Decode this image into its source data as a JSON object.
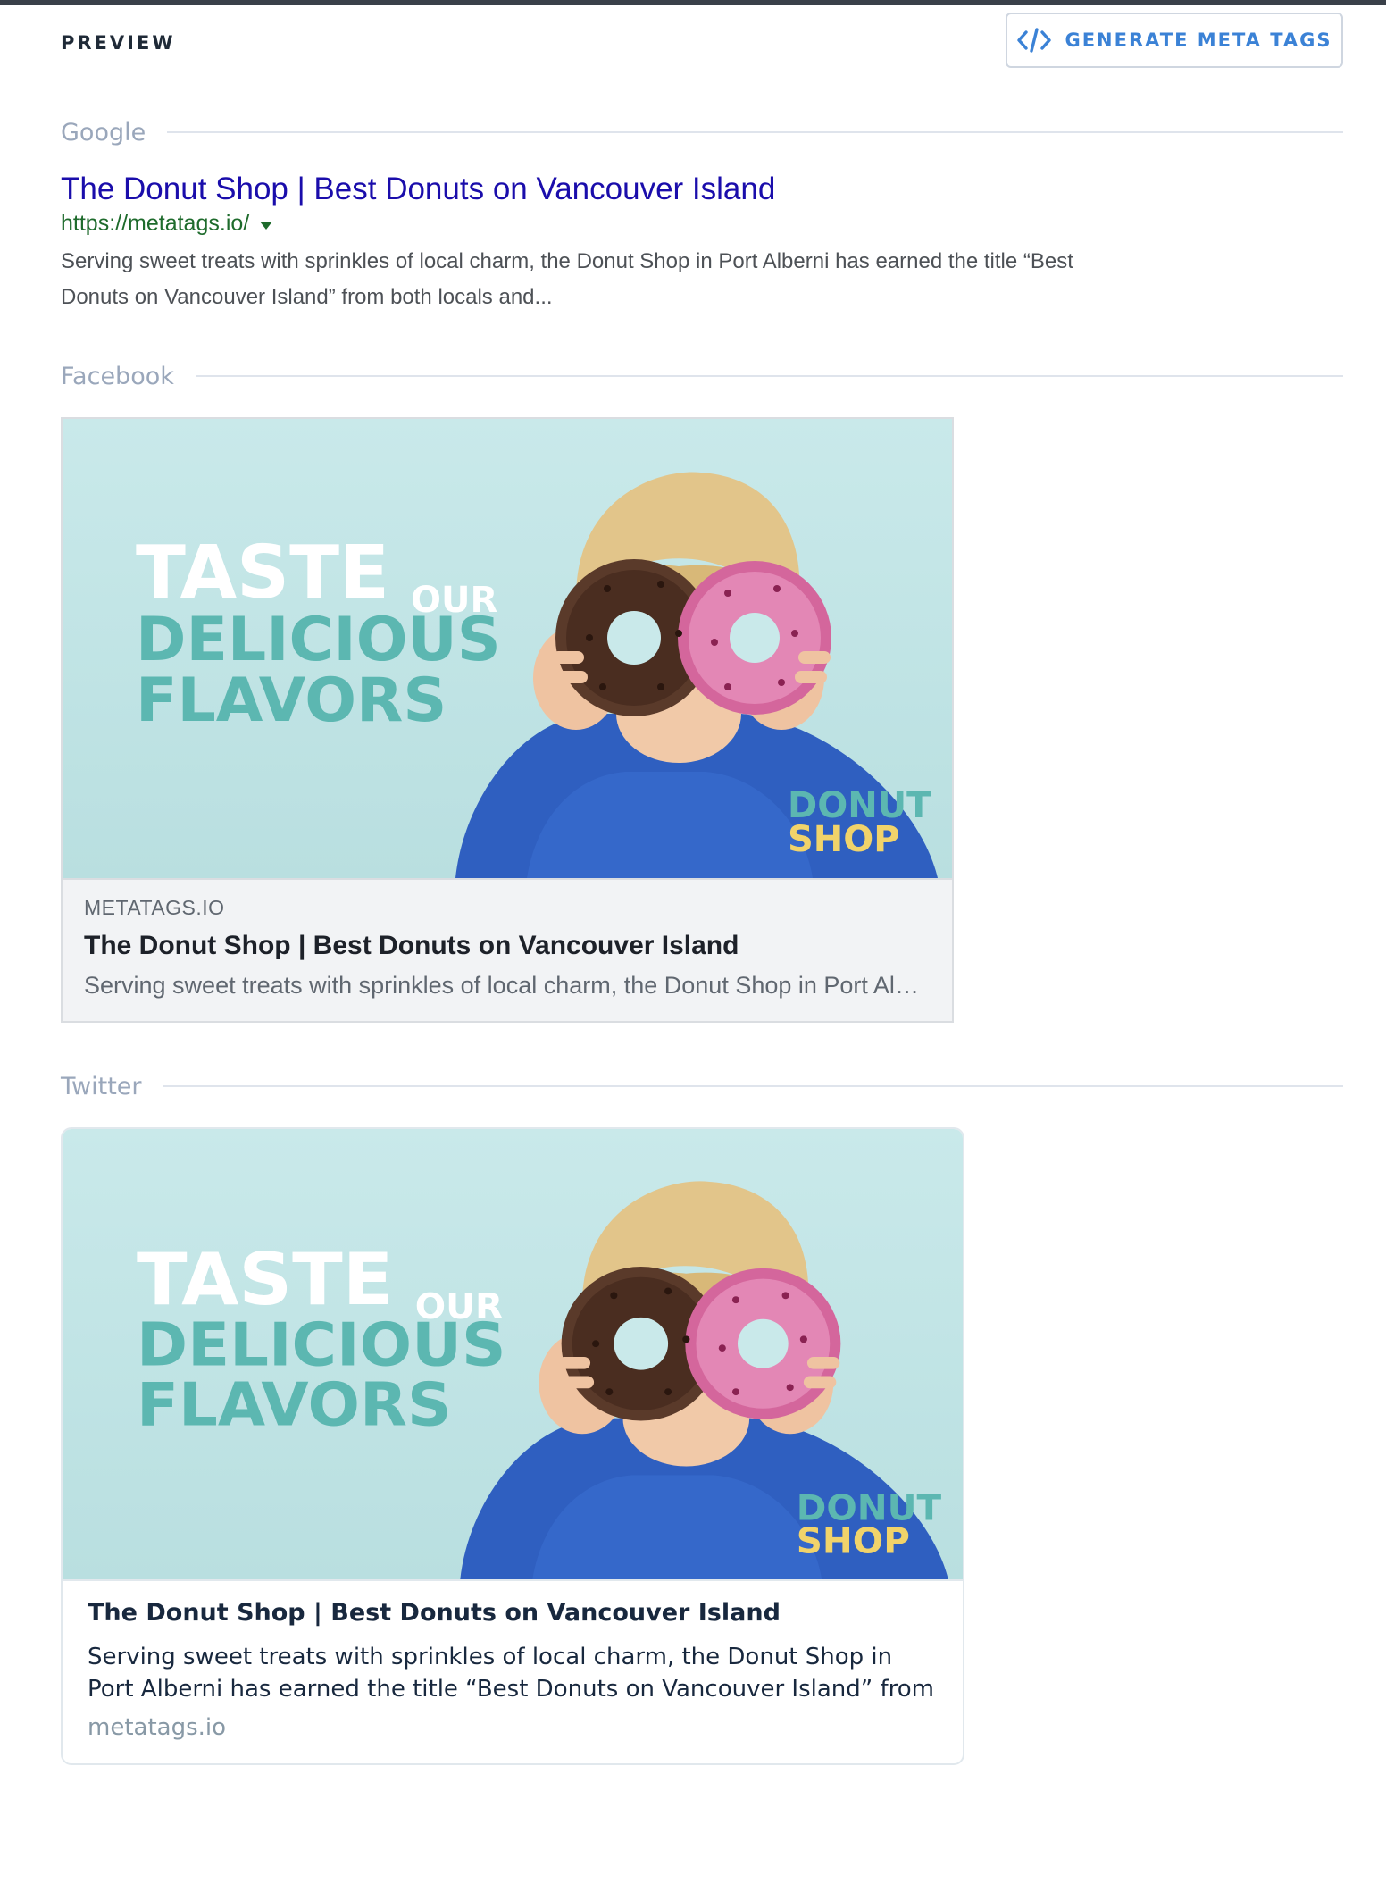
{
  "header": {
    "preview_label": "PREVIEW",
    "generate_button_label": "GENERATE META TAGS",
    "generate_button_icon": "code-icon",
    "accent_color": "#3b82d6"
  },
  "google": {
    "section_label": "Google",
    "title": "The Donut Shop | Best Donuts on Vancouver Island",
    "url": "https://metatags.io/",
    "url_caret_icon": "caret-down-icon",
    "description": "Serving sweet treats with sprinkles of local charm, the Donut Shop in Port Alberni has earned the title “Best Donuts on Vancouver Island” from both locals and...",
    "title_color": "#1a0dab",
    "url_color": "#1e6b2c"
  },
  "facebook": {
    "section_label": "Facebook",
    "image": {
      "headline_1": "TASTE",
      "headline_our": "OUR",
      "headline_2": "DELICIOUS",
      "headline_3": "FLAVORS",
      "logo_line_1": "DONUT",
      "logo_line_2": "SHOP"
    },
    "domain": "METATAGS.IO",
    "title": "The Donut Shop | Best Donuts on Vancouver Island",
    "description": "Serving sweet treats with sprinkles of local charm, the Donut Shop in Port Alberni has earned the title “Best Donuts on Vancouver Island” from both locals and..."
  },
  "twitter": {
    "section_label": "Twitter",
    "image": {
      "headline_1": "TASTE",
      "headline_our": "OUR",
      "headline_2": "DELICIOUS",
      "headline_3": "FLAVORS",
      "logo_line_1": "DONUT",
      "logo_line_2": "SHOP"
    },
    "title": "The Donut Shop | Best Donuts on Vancouver Island",
    "description": "Serving sweet treats with sprinkles of local charm, the Donut Shop in Port Alberni has earned the title “Best Donuts on Vancouver Island” from bot…",
    "domain": "metatags.io"
  }
}
